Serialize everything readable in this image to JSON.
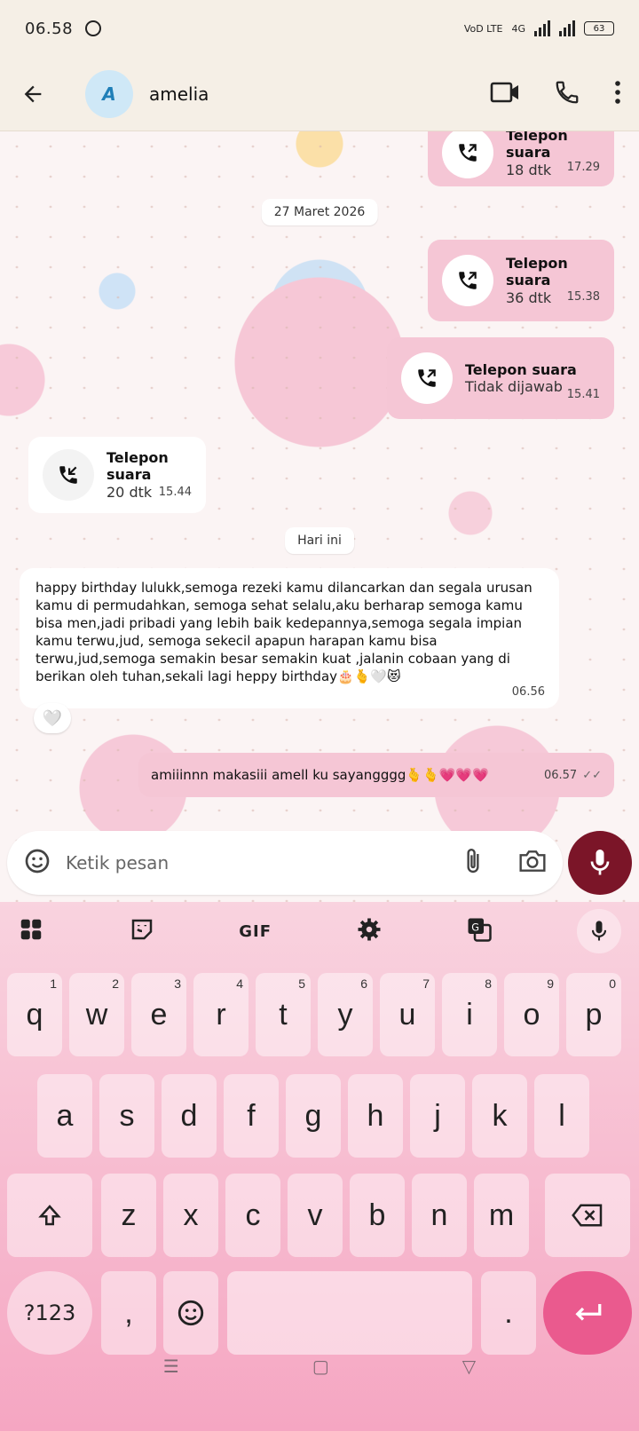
{
  "status": {
    "time": "06.58",
    "network": "4G",
    "volte": "VoD LTE",
    "battery": "63"
  },
  "header": {
    "contact_name": "amelia",
    "avatar_letter": "A"
  },
  "chat": {
    "call_top": {
      "title": "Telepon suara",
      "detail": "18 dtk",
      "time": "17.29"
    },
    "date1": "27 Maret 2026",
    "call2": {
      "title": "Telepon suara",
      "detail": "36 dtk",
      "time": "15.38"
    },
    "call3": {
      "title": "Telepon suara",
      "detail": "Tidak dijawab",
      "time": "15.41"
    },
    "call4": {
      "title": "Telepon suara",
      "detail": "20 dtk",
      "time": "15.44"
    },
    "date2": "Hari ini",
    "incoming_message": "happy birthday lulukk,semoga rezeki kamu dilancarkan dan segala urusan kamu di permudahkan, semoga sehat selalu,aku berharap semoga kamu bisa men,jadi pribadi yang lebih baik kedepannya,semoga segala impian kamu terwu,jud, semoga sekecil apapun harapan kamu bisa terwu,jud,semoga semakin besar semakin kuat ,jalanin cobaan yang di berikan oleh tuhan,sekali lagi heppy birthday🎂🫰🤍😻",
    "incoming_time": "06.56",
    "reaction": "🤍",
    "outgoing_message": "amiiinnn makasiii amell ku sayangggg🫰🫰💗💗💗",
    "outgoing_time": "06.57",
    "read_ticks": "✓✓"
  },
  "input": {
    "placeholder": "Ketik pesan"
  },
  "keyboard": {
    "gif_label": "GIF",
    "row1": [
      {
        "k": "q",
        "n": "1"
      },
      {
        "k": "w",
        "n": "2"
      },
      {
        "k": "e",
        "n": "3"
      },
      {
        "k": "r",
        "n": "4"
      },
      {
        "k": "t",
        "n": "5"
      },
      {
        "k": "y",
        "n": "6"
      },
      {
        "k": "u",
        "n": "7"
      },
      {
        "k": "i",
        "n": "8"
      },
      {
        "k": "o",
        "n": "9"
      },
      {
        "k": "p",
        "n": "0"
      }
    ],
    "row2": [
      "a",
      "s",
      "d",
      "f",
      "g",
      "h",
      "j",
      "k",
      "l"
    ],
    "row3": [
      "z",
      "x",
      "c",
      "v",
      "b",
      "n",
      "m"
    ],
    "symbols_label": "?123",
    "comma": ",",
    "period": "."
  }
}
